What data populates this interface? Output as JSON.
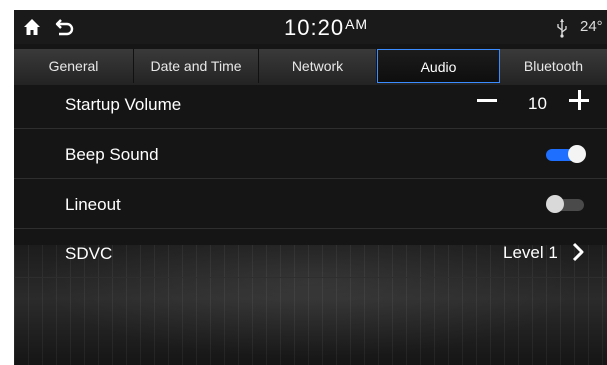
{
  "status_bar": {
    "time": "10:20",
    "ampm": "AM",
    "temperature": "24°",
    "icons": [
      "home-icon",
      "back-icon",
      "usb-icon"
    ]
  },
  "tabs": [
    {
      "label": "General",
      "active": false
    },
    {
      "label": "Date and Time",
      "active": false
    },
    {
      "label": "Network",
      "active": false
    },
    {
      "label": "Audio",
      "active": true
    },
    {
      "label": "Bluetooth",
      "active": false
    }
  ],
  "settings": {
    "startup_volume": {
      "label": "Startup Volume",
      "value": "10"
    },
    "beep_sound": {
      "label": "Beep Sound",
      "enabled": true
    },
    "lineout": {
      "label": "Lineout",
      "enabled": false
    },
    "sdvc": {
      "label": "SDVC",
      "value": "Level 1"
    }
  },
  "colors": {
    "accent": "#1e6fff",
    "tab_active_border": "#3b8dff",
    "background": "#151515"
  }
}
